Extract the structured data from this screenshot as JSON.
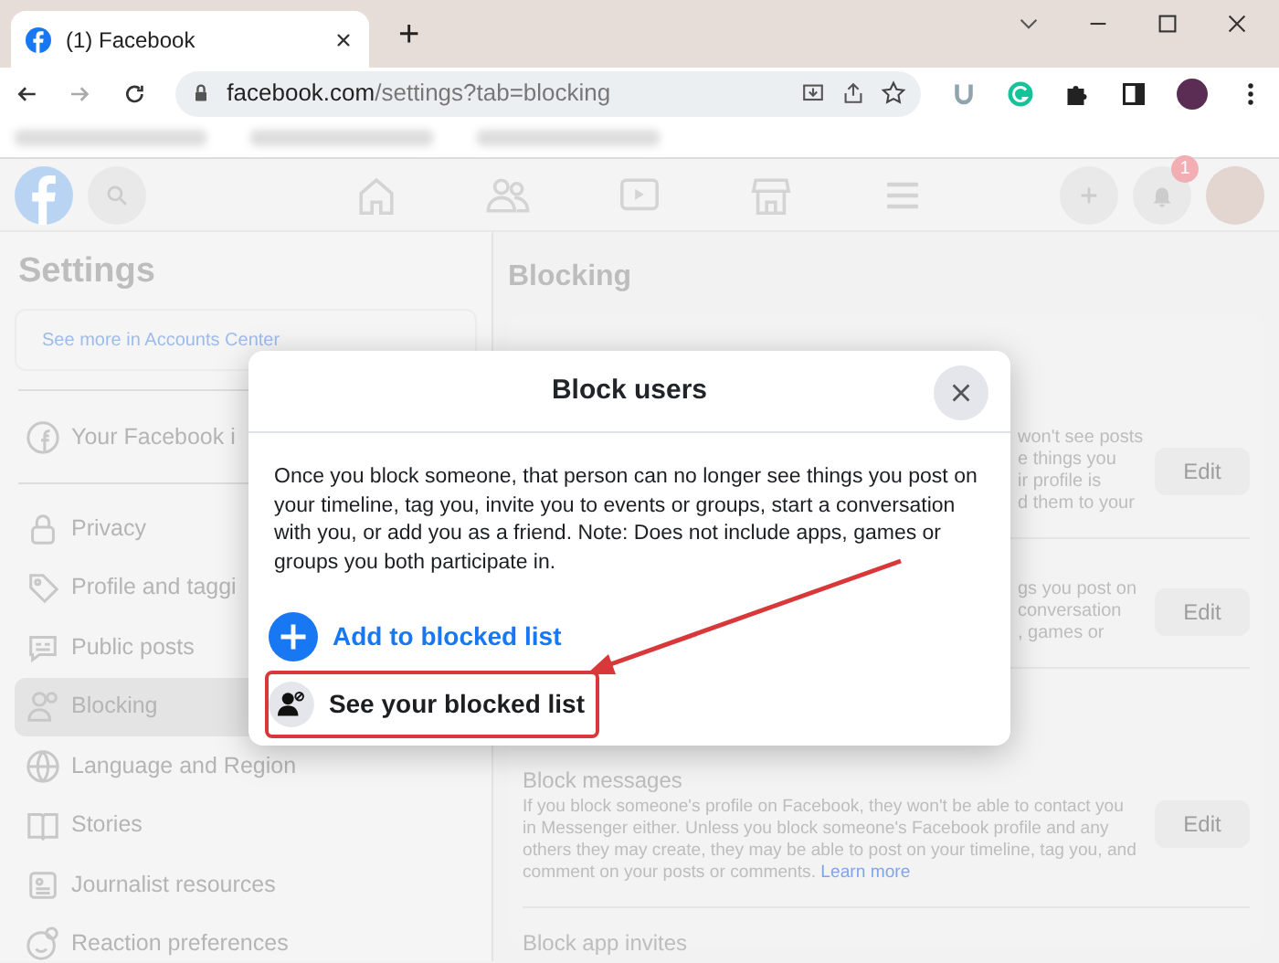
{
  "browser": {
    "tab_title": "(1) Facebook",
    "new_tab": "+",
    "url": {
      "domain": "facebook.com",
      "path": "/settings?tab=blocking"
    }
  },
  "facebook": {
    "notification_count": "1",
    "settings_title": "Settings",
    "accounts_center_link": "See more in Accounts Center",
    "sidebar": [
      {
        "label": "Your Facebook i",
        "selected": false,
        "group_end": true
      },
      {
        "label": "Privacy",
        "selected": false,
        "group_end": false
      },
      {
        "label": "Profile and taggi",
        "selected": false,
        "group_end": false
      },
      {
        "label": "Public posts",
        "selected": false,
        "group_end": false
      },
      {
        "label": "Blocking",
        "selected": true,
        "group_end": false
      },
      {
        "label": "Language and Region",
        "selected": false,
        "group_end": false
      },
      {
        "label": "Stories",
        "selected": false,
        "group_end": false
      },
      {
        "label": "Journalist resources",
        "selected": false,
        "group_end": false
      },
      {
        "label": "Reaction preferences",
        "selected": false,
        "group_end": false
      }
    ],
    "blocking_title": "Blocking",
    "sections": [
      {
        "fragments": [
          "won't see posts",
          "e things you",
          "ir profile is",
          "d them to your"
        ],
        "button": "Edit"
      },
      {
        "fragments": [
          "gs you post on",
          "conversation",
          ", games or"
        ],
        "button": "Edit"
      }
    ],
    "block_messages": {
      "title": "Block messages",
      "text": "If you block someone's profile on Facebook, they won't be able to contact you in Messenger either. Unless you block someone's Facebook profile and any others they may create, they may be able to post on your timeline, tag you, and comment on your posts or comments.",
      "link": "Learn more",
      "button": "Edit"
    },
    "block_app_invites": {
      "title": "Block app invites"
    }
  },
  "dialog": {
    "title": "Block users",
    "text": "Once you block someone, that person can no longer see things you post on your timeline, tag you, invite you to events or groups, start a conversation with you, or add you as a friend. Note: Does not include apps, games or groups you both participate in.",
    "actions": [
      {
        "kind": "add",
        "label": "Add to blocked list",
        "highlighted": false
      },
      {
        "kind": "list",
        "label": "See your blocked list",
        "highlighted": true
      }
    ]
  }
}
